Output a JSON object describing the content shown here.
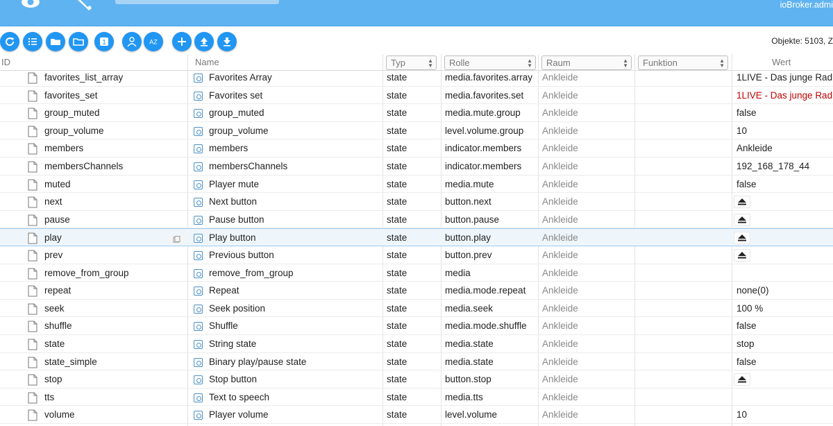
{
  "header": {
    "user_label": "ioBroker.admi"
  },
  "toolbar": {
    "object_count": "Objekte: 5103, Z",
    "sort_label": "AZ",
    "one_label": "1"
  },
  "columns": {
    "id": "ID",
    "name": "Name",
    "typ": "Typ",
    "role": "Rolle",
    "room": "Raum",
    "function": "Funktion",
    "value": "Wert"
  },
  "rows": [
    {
      "id": "favorites_list_array",
      "name": "Favorites Array",
      "typ": "state",
      "role": "media.favorites.array",
      "room": "Ankleide",
      "value": "1LIVE - Das junge Rad"
    },
    {
      "id": "favorites_set",
      "name": "Favorites set",
      "typ": "state",
      "role": "media.favorites.set",
      "room": "Ankleide",
      "value": "1LIVE - Das junge Rad"
    },
    {
      "id": "group_muted",
      "name": "group_muted",
      "typ": "state",
      "role": "media.mute.group",
      "room": "Ankleide",
      "value": "false"
    },
    {
      "id": "group_volume",
      "name": "group_volume",
      "typ": "state",
      "role": "level.volume.group",
      "room": "Ankleide",
      "value": "10"
    },
    {
      "id": "members",
      "name": "members",
      "typ": "state",
      "role": "indicator.members",
      "room": "Ankleide",
      "value": "Ankleide"
    },
    {
      "id": "membersChannels",
      "name": "membersChannels",
      "typ": "state",
      "role": "indicator.members",
      "room": "Ankleide",
      "value": "192_168_178_44"
    },
    {
      "id": "muted",
      "name": "Player mute",
      "typ": "state",
      "role": "media.mute",
      "room": "Ankleide",
      "value": "false"
    },
    {
      "id": "next",
      "name": "Next button",
      "typ": "state",
      "role": "button.next",
      "room": "Ankleide",
      "value": ""
    },
    {
      "id": "pause",
      "name": "Pause button",
      "typ": "state",
      "role": "button.pause",
      "room": "Ankleide",
      "value": ""
    },
    {
      "id": "play",
      "name": "Play button",
      "typ": "state",
      "role": "button.play",
      "room": "Ankleide",
      "value": ""
    },
    {
      "id": "prev",
      "name": "Previous button",
      "typ": "state",
      "role": "button.prev",
      "room": "Ankleide",
      "value": ""
    },
    {
      "id": "remove_from_group",
      "name": "remove_from_group",
      "typ": "state",
      "role": "media",
      "room": "Ankleide",
      "value": ""
    },
    {
      "id": "repeat",
      "name": "Repeat",
      "typ": "state",
      "role": "media.mode.repeat",
      "room": "Ankleide",
      "value": "none(0)"
    },
    {
      "id": "seek",
      "name": "Seek position",
      "typ": "state",
      "role": "media.seek",
      "room": "Ankleide",
      "value": "100 %"
    },
    {
      "id": "shuffle",
      "name": "Shuffle",
      "typ": "state",
      "role": "media.mode.shuffle",
      "room": "Ankleide",
      "value": "false"
    },
    {
      "id": "state",
      "name": "String state",
      "typ": "state",
      "role": "media.state",
      "room": "Ankleide",
      "value": "stop"
    },
    {
      "id": "state_simple",
      "name": "Binary play/pause state",
      "typ": "state",
      "role": "media.state",
      "room": "Ankleide",
      "value": "false"
    },
    {
      "id": "stop",
      "name": "Stop button",
      "typ": "state",
      "role": "button.stop",
      "room": "Ankleide",
      "value": ""
    },
    {
      "id": "tts",
      "name": "Text to speech",
      "typ": "state",
      "role": "media.tts",
      "room": "Ankleide",
      "value": ""
    },
    {
      "id": "volume",
      "name": "Player volume",
      "typ": "state",
      "role": "level.volume",
      "room": "Ankleide",
      "value": "10"
    }
  ],
  "selected_row": "play",
  "button_value_rows": [
    "next",
    "pause",
    "play",
    "prev",
    "stop"
  ],
  "red_value_rows": [
    "favorites_set"
  ],
  "icons": {
    "appbar": [
      "eye-icon",
      "wrench-icon"
    ],
    "toolbar": [
      "refresh-icon",
      "list-icon",
      "folder-icon",
      "folder-open-icon",
      "one-icon",
      "user-icon",
      "sort-az-icon",
      "add-icon",
      "upload-icon",
      "download-icon"
    ],
    "row": [
      "file-icon",
      "state-icon",
      "copy-icon",
      "eject-icon"
    ]
  },
  "colors": {
    "accent": "#2196f3",
    "header": "#5fb3f1",
    "selected": "#eef6fc",
    "warning": "#c00000"
  }
}
